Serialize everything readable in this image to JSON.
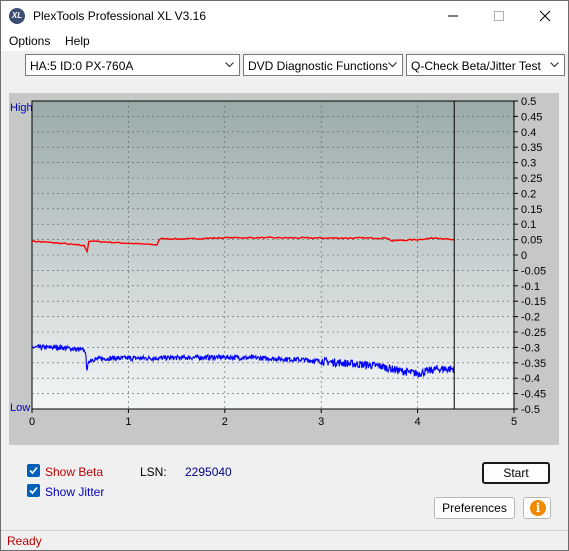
{
  "window": {
    "title": "PlexTools Professional XL V3.16",
    "icon_text": "XL"
  },
  "menu": {
    "options_label": "Options",
    "help_label": "Help"
  },
  "toolbar": {
    "drive_value": "HA:5 ID:0  PX-760A",
    "function_value": "DVD Diagnostic Functions",
    "test_value": "Q-Check Beta/Jitter Test"
  },
  "chart_data": {
    "type": "line",
    "x_ticks": [
      "0",
      "1",
      "2",
      "3",
      "4",
      "5"
    ],
    "xlim": [
      0,
      5
    ],
    "y_left_labels": {
      "top": "High",
      "bottom": "Low"
    },
    "y_right_ticks": [
      "0.5",
      "0.45",
      "0.4",
      "0.35",
      "0.3",
      "0.25",
      "0.2",
      "0.15",
      "0.1",
      "0.05",
      "0",
      "-0.05",
      "-0.1",
      "-0.15",
      "-0.2",
      "-0.25",
      "-0.3",
      "-0.35",
      "-0.4",
      "-0.45",
      "-0.5"
    ],
    "ylim": [
      -0.5,
      0.5
    ],
    "grid": true,
    "end_marker_x": 4.38,
    "series": [
      {
        "color": "#ff0000",
        "x": [
          0,
          0.3,
          0.55,
          0.57,
          0.58,
          0.62,
          1.0,
          1.3,
          1.32,
          1.6,
          2.0,
          2.5,
          3.0,
          3.5,
          3.7,
          3.72,
          4.0,
          4.2,
          4.38
        ],
        "y": [
          0.045,
          0.038,
          0.03,
          0.0,
          0.045,
          0.045,
          0.038,
          0.033,
          0.053,
          0.052,
          0.056,
          0.056,
          0.055,
          0.055,
          0.055,
          0.046,
          0.05,
          0.056,
          0.048
        ]
      },
      {
        "color": "#0000ff",
        "x": [
          0,
          0.3,
          0.55,
          0.57,
          0.6,
          0.8,
          1.2,
          1.6,
          2.0,
          2.4,
          2.8,
          3.0,
          3.2,
          3.4,
          3.6,
          3.8,
          4.0,
          4.2,
          4.38
        ],
        "y": [
          -0.3,
          -0.3,
          -0.31,
          -0.37,
          -0.34,
          -0.335,
          -0.335,
          -0.333,
          -0.332,
          -0.335,
          -0.34,
          -0.345,
          -0.35,
          -0.355,
          -0.36,
          -0.375,
          -0.385,
          -0.37,
          -0.37
        ]
      }
    ]
  },
  "controls": {
    "show_beta_label": "Show Beta",
    "show_jitter_label": "Show Jitter",
    "lsn_label": "LSN:",
    "lsn_value": "2295040",
    "start_label": "Start",
    "preferences_label": "Preferences",
    "info_symbol": "i"
  },
  "status": {
    "text": "Ready"
  },
  "colors": {
    "beta_label": "#c00000",
    "jitter_label": "#0000c0",
    "checkbox": "#005fb8"
  }
}
